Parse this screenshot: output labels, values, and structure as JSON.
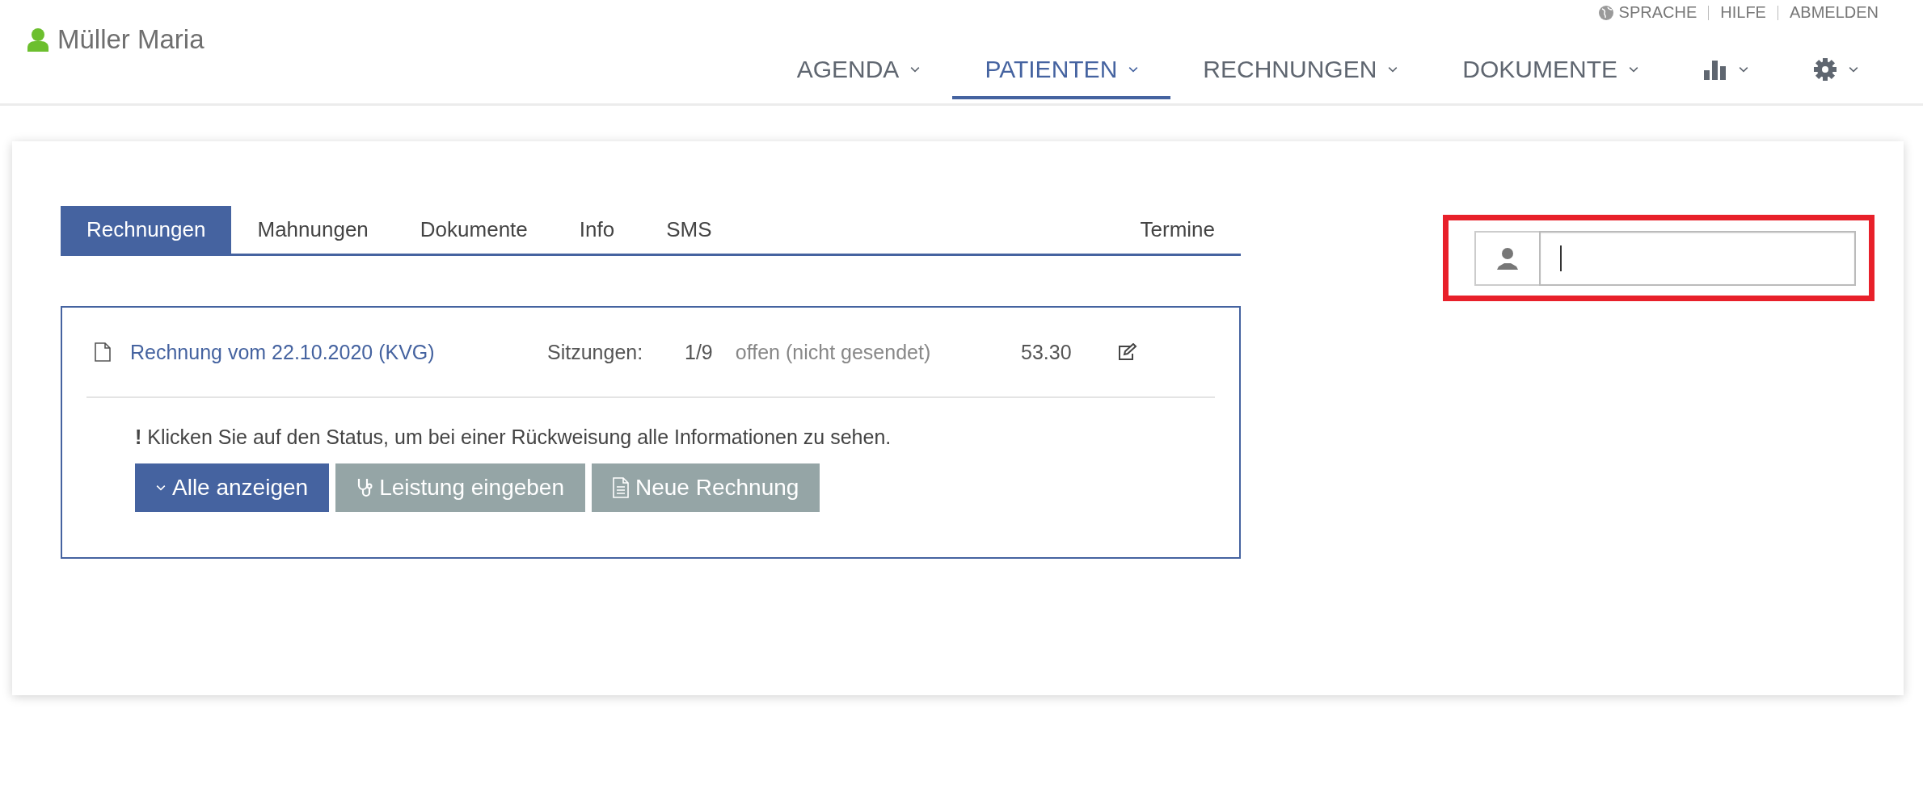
{
  "user": {
    "name": "Müller Maria"
  },
  "top_links": [
    "SPRACHE",
    "HILFE",
    "ABMELDEN"
  ],
  "nav": [
    {
      "kind": "text",
      "label": "AGENDA",
      "selected": false
    },
    {
      "kind": "text",
      "label": "PATIENTEN",
      "selected": true
    },
    {
      "kind": "text",
      "label": "RECHNUNGEN",
      "selected": false
    },
    {
      "kind": "text",
      "label": "DOKUMENTE",
      "selected": false
    },
    {
      "kind": "chart",
      "selected": false
    },
    {
      "kind": "gear",
      "selected": false
    }
  ],
  "tabs": [
    {
      "label": "Rechnungen",
      "selected": true
    },
    {
      "label": "Mahnungen",
      "selected": false
    },
    {
      "label": "Dokumente",
      "selected": false
    },
    {
      "label": "Info",
      "selected": false
    },
    {
      "label": "SMS",
      "selected": false
    }
  ],
  "tabs_right": [
    {
      "label": "Termine",
      "selected": false
    }
  ],
  "invoices": [
    {
      "title": "Rechnung vom 22.10.2020 (KVG)",
      "sessions_label": "Sitzungen:",
      "sessions": "1/9",
      "status": "offen (nicht gesendet)",
      "amount": "53.30"
    }
  ],
  "note": "**!** Klicken Sie auf den Status, um bei einer Rückweisung alle Informationen zu sehen.",
  "buttons": [
    {
      "label": "Alle anzeigen",
      "kind": "primary"
    },
    {
      "label": "Leistung eingeben",
      "kind": "secondary"
    },
    {
      "label": "Neue Rechnung",
      "kind": "secondary"
    }
  ],
  "search": {
    "focused": true
  }
}
